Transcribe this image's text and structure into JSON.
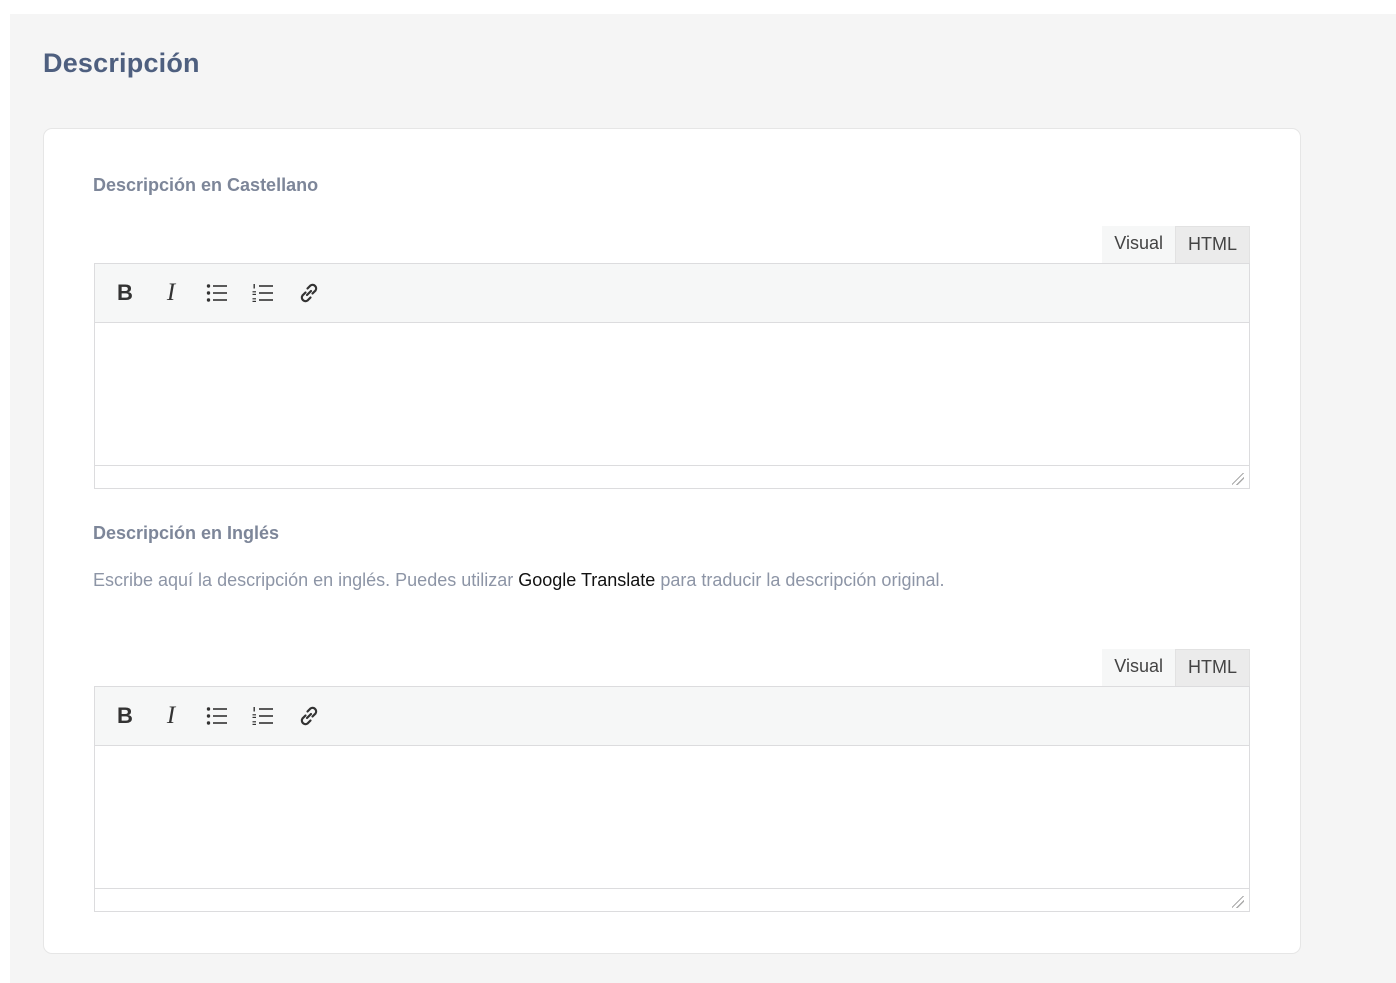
{
  "section": {
    "title": "Descripción"
  },
  "spanish": {
    "label": "Descripción en Castellano",
    "tabs": {
      "visual": "Visual",
      "html": "HTML"
    },
    "toolbar": {
      "bold": "B",
      "italic": "I"
    },
    "content": ""
  },
  "english": {
    "label": "Descripción en Inglés",
    "help": {
      "before": "Escribe aquí la descripción en inglés. Puedes utilizar ",
      "link": "Google Translate",
      "after": " para traducir la descripción original."
    },
    "tabs": {
      "visual": "Visual",
      "html": "HTML"
    },
    "toolbar": {
      "bold": "B",
      "italic": "I"
    },
    "content": ""
  },
  "icons": [
    "bulleted-list-icon",
    "numbered-list-icon",
    "link-icon",
    "resize-handle-icon"
  ],
  "colors": {
    "title": "#4e5f7f",
    "label": "#7d8699",
    "help": "#8d95a6",
    "panel": "#f5f5f5"
  }
}
